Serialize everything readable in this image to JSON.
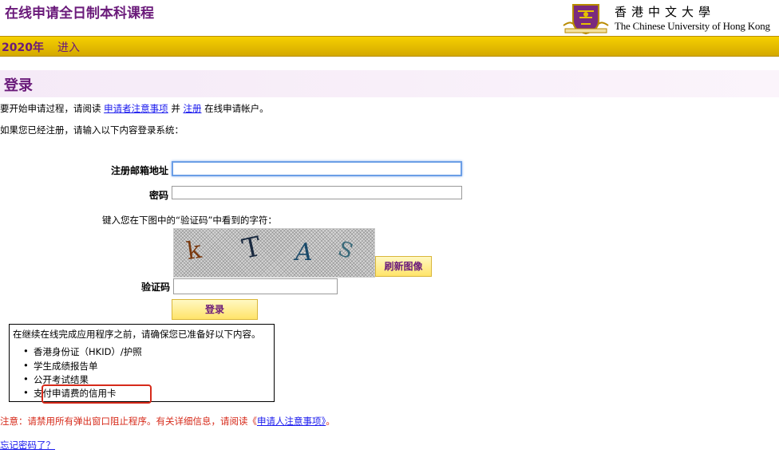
{
  "header": {
    "app_title": "在线申请全日制本科课程",
    "logo_cn": "香港中文大學",
    "logo_en": "The Chinese University of Hong Kong"
  },
  "nav": {
    "year": "2020年",
    "enter": "进入"
  },
  "section": {
    "title": "登录"
  },
  "intro": {
    "line1_prefix": "要开始申请过程，请阅读",
    "notes_link": "申请者注意事项",
    "and": "并",
    "register_link": "注册",
    "line1_suffix": "在线申请帐户。",
    "line2": "如果您已经注册，请输入以下内容登录系统："
  },
  "form": {
    "email_label": "注册邮箱地址",
    "email_value": "",
    "password_label": "密码",
    "password_value": "",
    "captcha_prompt": "键入您在下图中的“验证码”中看到的字符：",
    "captcha_chars": [
      "k",
      "T",
      "A",
      "S"
    ],
    "refresh_label": "刷新图像",
    "captcha_label": "验证码",
    "captcha_value": "",
    "login_label": "登录"
  },
  "checklist": {
    "intro": "在继续在线完成应用程序之前，请确保您已准备好以下内容。",
    "items": [
      "香港身份证（HKID）/护照",
      "学生成绩报告单",
      "公开考试结果",
      "支付申请费的信用卡"
    ]
  },
  "notice": {
    "prefix": "注意：请禁用所有弹出窗口阻止程序。有关详细信息，请阅读《",
    "link": "申请人注意事项》",
    "suffix": "。"
  },
  "forgot_password": "忘记密码了？",
  "colors": {
    "brand_purple": "#6a1a7a",
    "nav_gold": "#e6bd00",
    "highlight_red": "#d62a1a",
    "link_blue": "#1a1aee"
  }
}
